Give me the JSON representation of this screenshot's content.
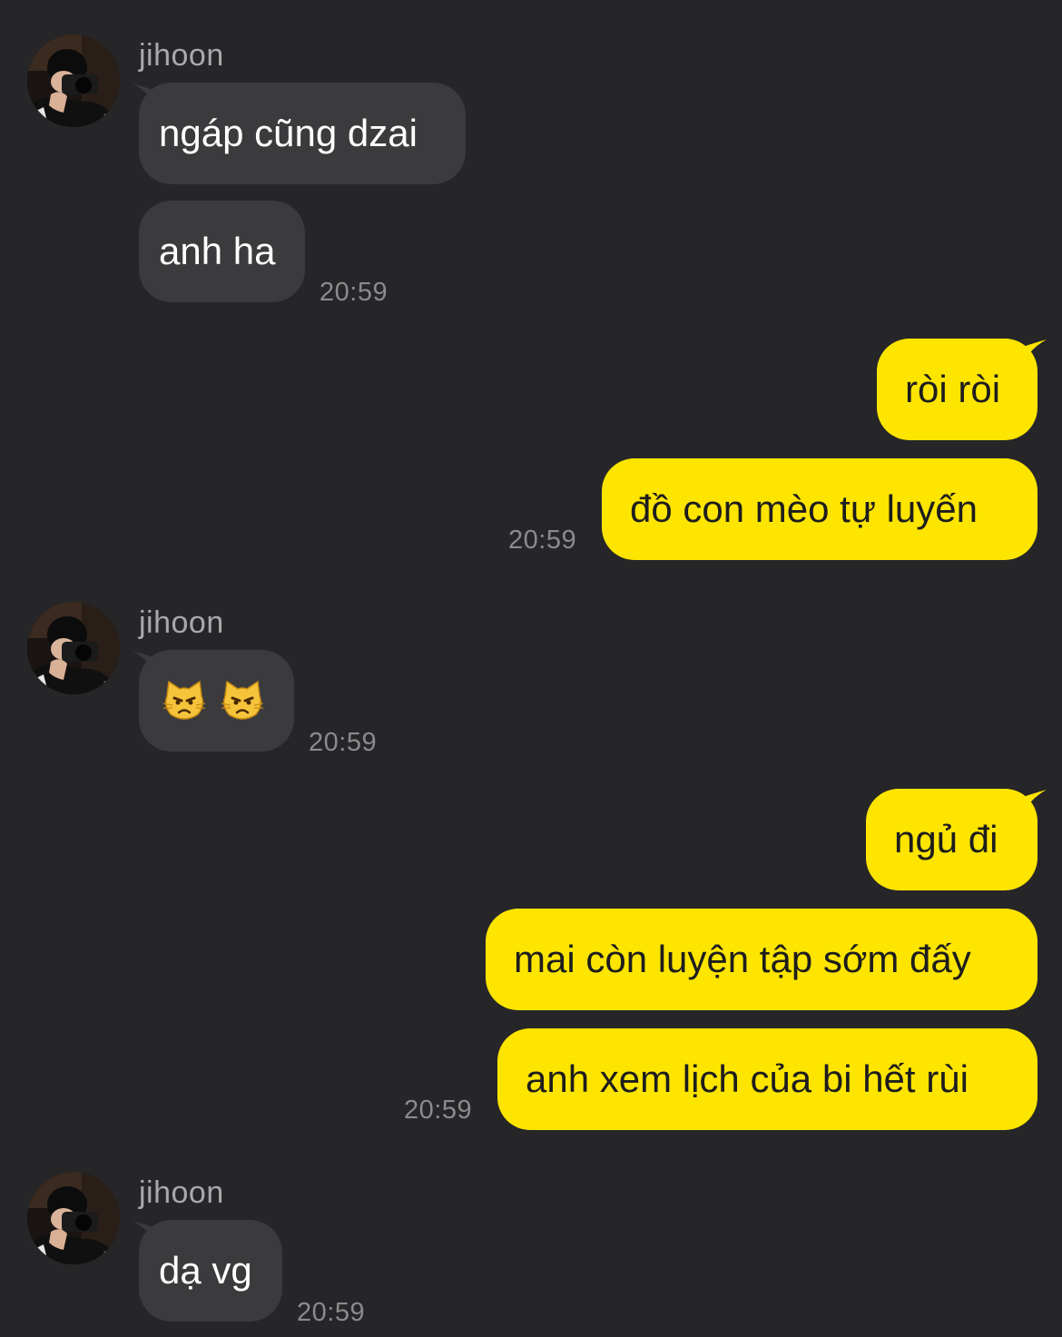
{
  "colors": {
    "background": "#262628",
    "incoming_bubble": "#3b3b3d",
    "outgoing_bubble": "#fee500",
    "timestamp": "#8b8b8d",
    "sender_name": "#a9a9ab"
  },
  "messages": {
    "g1": {
      "sender": "jihoon",
      "m1": "ngáp cũng dzai",
      "m2": "anh ha",
      "time": "20:59"
    },
    "g2": {
      "m1": "ròi ròi",
      "m2": "đồ con mèo tự luyến",
      "time": "20:59"
    },
    "g3": {
      "sender": "jihoon",
      "emoji": [
        "pouting-cat",
        "pouting-cat"
      ],
      "time": "20:59"
    },
    "g4": {
      "m1": "ngủ đi",
      "m2": "mai còn luyện tập sớm đấy",
      "m3": "anh xem lịch của bi hết rùi",
      "time": "20:59"
    },
    "g5": {
      "sender": "jihoon",
      "m1": "dạ vg",
      "time": "20:59"
    }
  }
}
